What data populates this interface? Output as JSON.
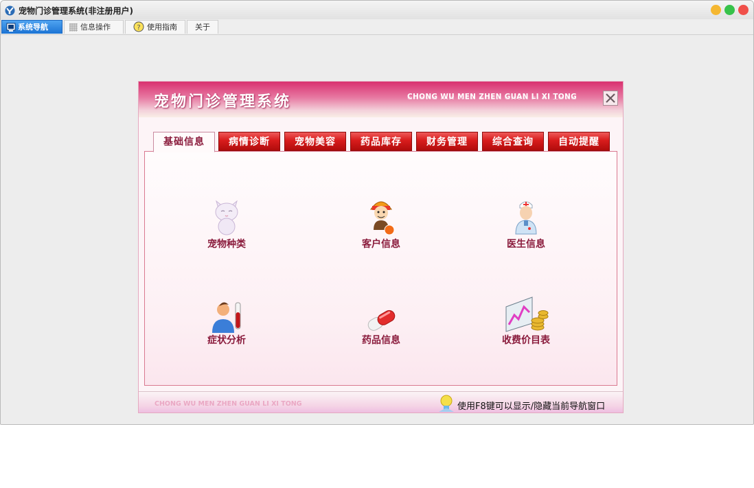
{
  "window": {
    "title": "宠物门诊管理系统(非注册用户)"
  },
  "menubar": {
    "tabs": [
      {
        "label": "系统导航",
        "icon": "monitor-icon",
        "active": true
      },
      {
        "label": "信息操作",
        "icon": "grid-icon",
        "active": false
      },
      {
        "label": "使用指南",
        "icon": "help-icon",
        "active": false
      },
      {
        "label": "关于",
        "icon": "",
        "active": false
      }
    ]
  },
  "panel": {
    "title": "宠物门诊管理系统",
    "subtitle": "CHONG WU MEN ZHEN GUAN LI XI TONG",
    "tabs": [
      "基础信息",
      "病情诊断",
      "宠物美容",
      "药品库存",
      "财务管理",
      "综合查询",
      "自动提醒"
    ],
    "active_tab": 0,
    "items": [
      {
        "label": "宠物种类",
        "icon": "cat-icon"
      },
      {
        "label": "客户信息",
        "icon": "customer-icon"
      },
      {
        "label": "医生信息",
        "icon": "doctor-icon"
      },
      {
        "label": "症状分析",
        "icon": "symptom-icon"
      },
      {
        "label": "药品信息",
        "icon": "pill-icon"
      },
      {
        "label": "收费价目表",
        "icon": "price-chart-icon"
      }
    ],
    "footer_text": "CHONG WU MEN ZHEN  GUAN LI XI TONG",
    "footer_hint": "使用F8键可以显示/隐藏当前导航窗口"
  },
  "colors": {
    "accent": "#d81c1c",
    "header_pink": "#d9306f",
    "label": "#8a1b3c",
    "tab_active_blue": "#1b73d4"
  }
}
